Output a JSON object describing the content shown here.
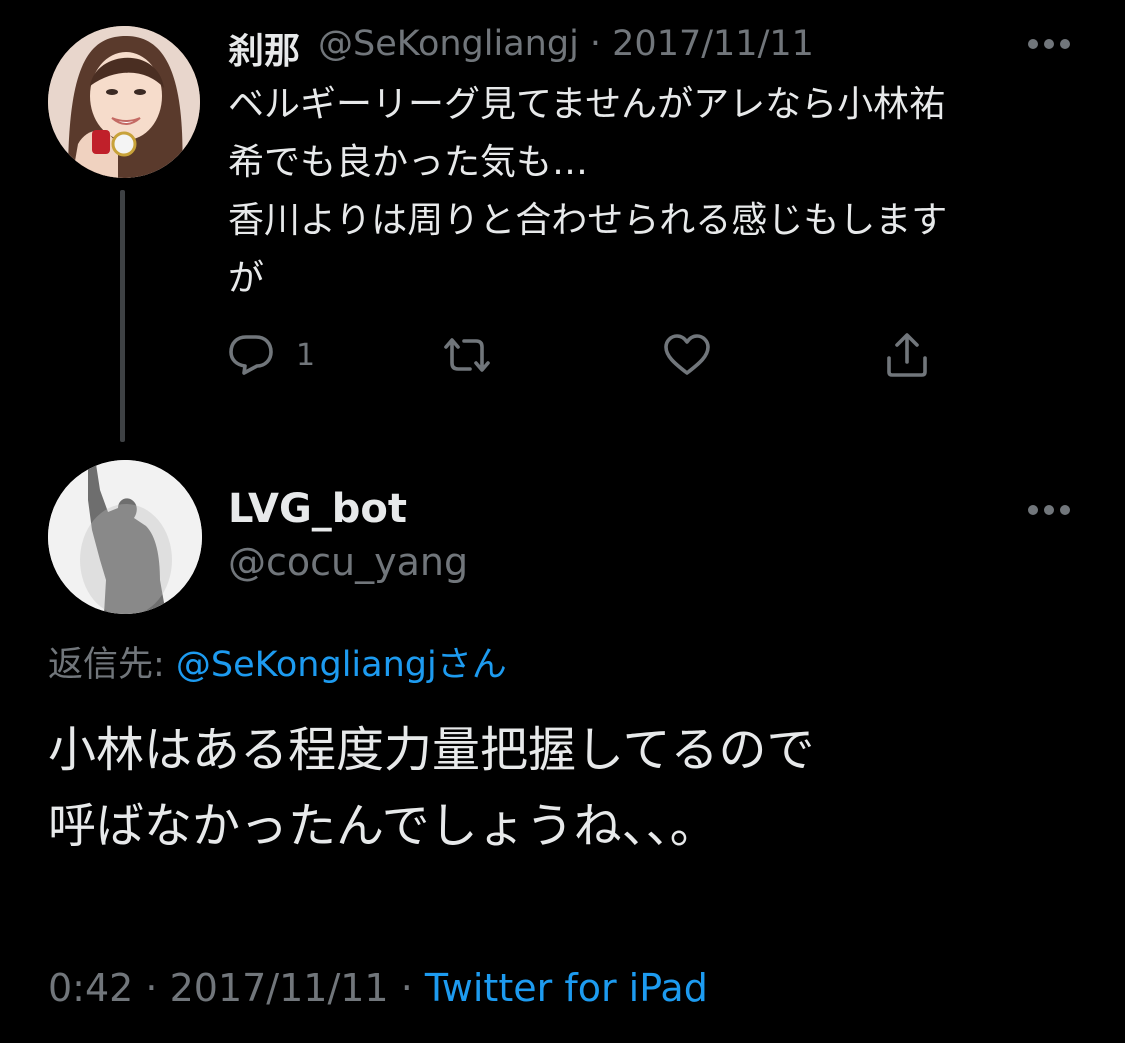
{
  "parent_tweet": {
    "display_name": "刹那",
    "handle_date": "@SeKongliangj · 2017/11/11",
    "text": "ベルギーリーグ見てませんがアレなら小林祐\n希でも良かった気も…\n香川よりは周りと合わせられる感じもします\nが",
    "reply_count": "1",
    "avatar_icon": "profile-photo-woman"
  },
  "main_tweet": {
    "display_name": "LVG_bot",
    "handle": "@cocu_yang",
    "replying_prefix": "返信先: ",
    "replying_mention": "@SeKongliangj",
    "replying_suffix": "さん",
    "text": "小林はある程度力量把握してるので\n呼ばなかったんでしょうね、、。",
    "time": "0:42",
    "date": "2017/11/11",
    "separator": " · ",
    "source": "Twitter for iPad",
    "avatar_icon": "profile-photo-silhouette"
  },
  "icons": {
    "more": "more-horizontal-icon",
    "reply": "reply-bubble-icon",
    "retweet": "retweet-icon",
    "like": "heart-icon",
    "share": "share-upload-icon"
  },
  "colors": {
    "background": "#000000",
    "text_primary": "#e7e9ea",
    "text_secondary": "#71767b",
    "link": "#1d9bf0",
    "thread_line": "#3e4144"
  }
}
